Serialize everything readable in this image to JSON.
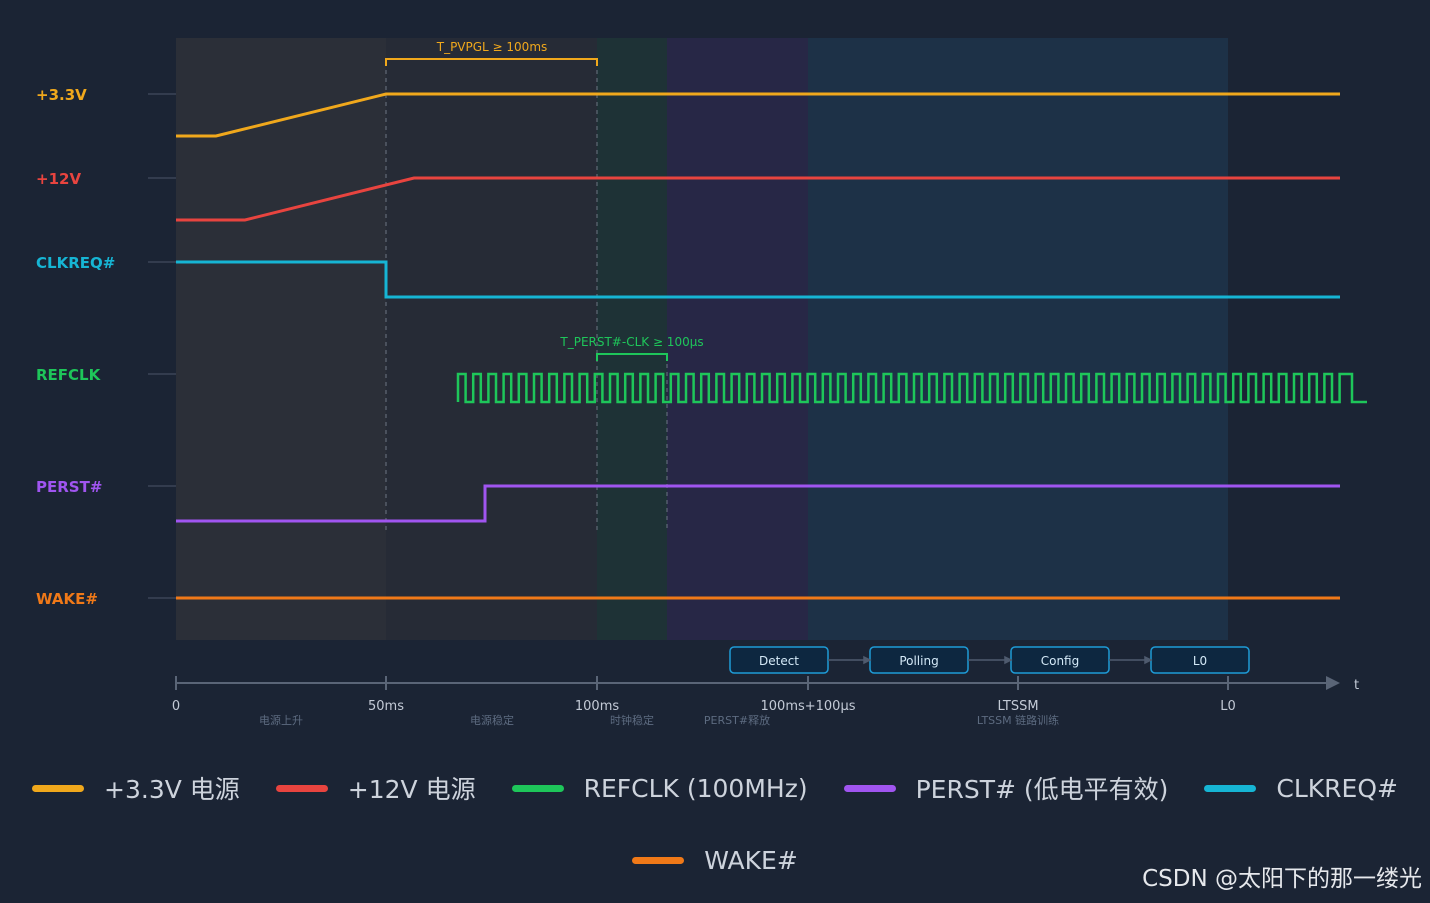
{
  "annotations": {
    "pvpgl": "T_PVPGL ≥ 100ms",
    "perst_clk": "T_PERST#-CLK ≥ 100μs"
  },
  "signals": [
    {
      "id": "v33",
      "label": "+3.3V",
      "color": "#f0a81c"
    },
    {
      "id": "v12",
      "label": "+12V",
      "color": "#e8443f"
    },
    {
      "id": "clkreq",
      "label": "CLKREQ#",
      "color": "#16b5d4"
    },
    {
      "id": "refclk",
      "label": "REFCLK",
      "color": "#1ec65a"
    },
    {
      "id": "perst",
      "label": "PERST#",
      "color": "#a055f0"
    },
    {
      "id": "wake",
      "label": "WAKE#",
      "color": "#f07918"
    }
  ],
  "time_axis": {
    "ticks": [
      "0",
      "50ms",
      "100ms",
      "100ms+100μs",
      "LTSSM",
      "L0"
    ],
    "unit": "t"
  },
  "phases": [
    "电源上升",
    "电源稳定",
    "时钟稳定",
    "PERST#释放",
    "LTSSM 链路训练"
  ],
  "ltssm_states": [
    "Detect",
    "Polling",
    "Config",
    "L0"
  ],
  "legend": [
    {
      "label": "+3.3V 电源",
      "color": "#f0a81c"
    },
    {
      "label": "+12V 电源",
      "color": "#e8443f"
    },
    {
      "label": "REFCLK (100MHz)",
      "color": "#1ec65a"
    },
    {
      "label": "PERST# (低电平有效)",
      "color": "#a055f0"
    },
    {
      "label": "CLKREQ#",
      "color": "#16b5d4"
    },
    {
      "label": "WAKE#",
      "color": "#f07918"
    }
  ],
  "watermark": "CSDN @太阳下的那一缕光",
  "colors": {
    "background": "#1b2434",
    "axis": "#5a6577",
    "bracket_pvpgl": "#f0a81c",
    "bracket_perst": "#1ec65a",
    "state_box_fill": "#0d2740",
    "state_box_border": "#1e9bd6"
  }
}
